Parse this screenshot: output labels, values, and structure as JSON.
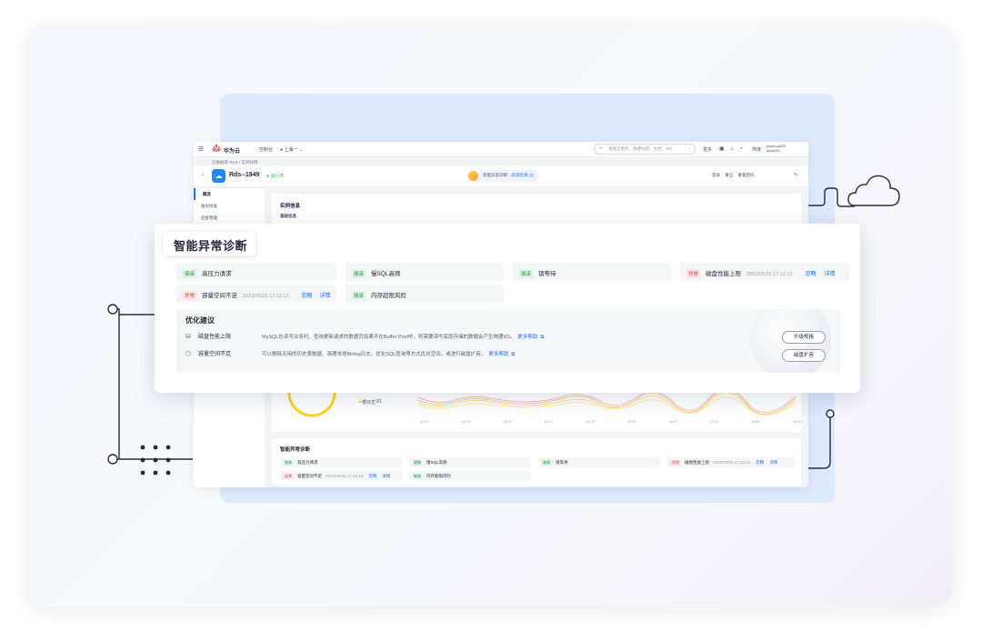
{
  "topbar": {
    "brand": "华为云",
    "console": "控制台",
    "region": "上海一",
    "search_placeholder": "请搜云服务、快捷导航、文档、API",
    "search_key": "/",
    "more": "更多",
    "lang": "简体",
    "user_line1": "jixuehua001",
    "user_line2": "dave001"
  },
  "breadcrumb": "云数据库 RDS / 实例详情",
  "header": {
    "instance_name": "Rds--1949",
    "status": "运行中",
    "ai_label": "智能异常诊断",
    "ai_badge": "异常检测 (2)",
    "actions": [
      "登录",
      "重启",
      "重置密码"
    ]
  },
  "sidebar": {
    "items": [
      "概览",
      "备份恢复",
      "连接管理"
    ]
  },
  "main_card": {
    "title": "实例信息",
    "subtitle": "基础信息"
  },
  "chart_fragment": {
    "legend": "慢日志",
    "legend_value": "91",
    "x_ticks": [
      "12:07",
      "12:57",
      "13:47",
      "14:17",
      "14:47",
      "15:37",
      "16:27",
      "17:17",
      "18:07",
      "18:57"
    ]
  },
  "popup": {
    "title": "智能异常诊断",
    "diag_items": [
      {
        "status": "健康",
        "kind": "ok",
        "label": "高压力请求"
      },
      {
        "status": "健康",
        "kind": "ok",
        "label": "慢SQL高频"
      },
      {
        "status": "健康",
        "kind": "ok",
        "label": "锁等待"
      },
      {
        "status": "异常",
        "kind": "bad",
        "label": "磁盘性能上限",
        "time": "2023/05/25 17:12:12",
        "ignore": "忽略",
        "detail": "详情"
      },
      {
        "status": "异常",
        "kind": "bad",
        "label": "容量空间不足",
        "time": "2023/05/25 17:12:12",
        "ignore": "忽略",
        "detail": "详情"
      },
      {
        "status": "健康",
        "kind": "ok",
        "label": "内存超限风险"
      }
    ],
    "optimization": {
      "title": "优化建议",
      "rows": [
        {
          "name": "磁盘性能上限",
          "desc": "MySQL在读写业务时、查询更新请求的数据页如果不在Buffer Pool中，则需要读写底层存储的数据会产生物理I/O。",
          "link": "更多帮助"
        },
        {
          "name": "容量空间不足",
          "desc": "可以删除无用的历史表数据、清理本地Binlog日志、优化SQL查询等方式优化空间，或进行磁盘扩容。",
          "link": "更多帮助"
        }
      ],
      "buttons": [
        "升级规格",
        "磁盘扩容"
      ]
    }
  },
  "diag_card2": {
    "title": "智能异常诊断",
    "items": [
      {
        "status": "健康",
        "kind": "ok",
        "label": "高压力请求"
      },
      {
        "status": "健康",
        "kind": "ok",
        "label": "慢SQL高频"
      },
      {
        "status": "健康",
        "kind": "ok",
        "label": "锁等待"
      },
      {
        "status": "异常",
        "kind": "bad",
        "label": "磁盘性能上限",
        "time": "2023/05/25 17:12:12",
        "ignore": "忽略",
        "detail": "详情"
      },
      {
        "status": "异常",
        "kind": "bad",
        "label": "容量空间不足",
        "time": "2023/05/25 17:12:12",
        "ignore": "忽略",
        "detail": "详情"
      },
      {
        "status": "健康",
        "kind": "ok",
        "label": "内存超限风险"
      }
    ]
  },
  "colors": {
    "accent": "#1e6ff1",
    "ok": "#2f9b4f",
    "bad": "#e0393e",
    "panel_blue": "#dde9fc"
  }
}
